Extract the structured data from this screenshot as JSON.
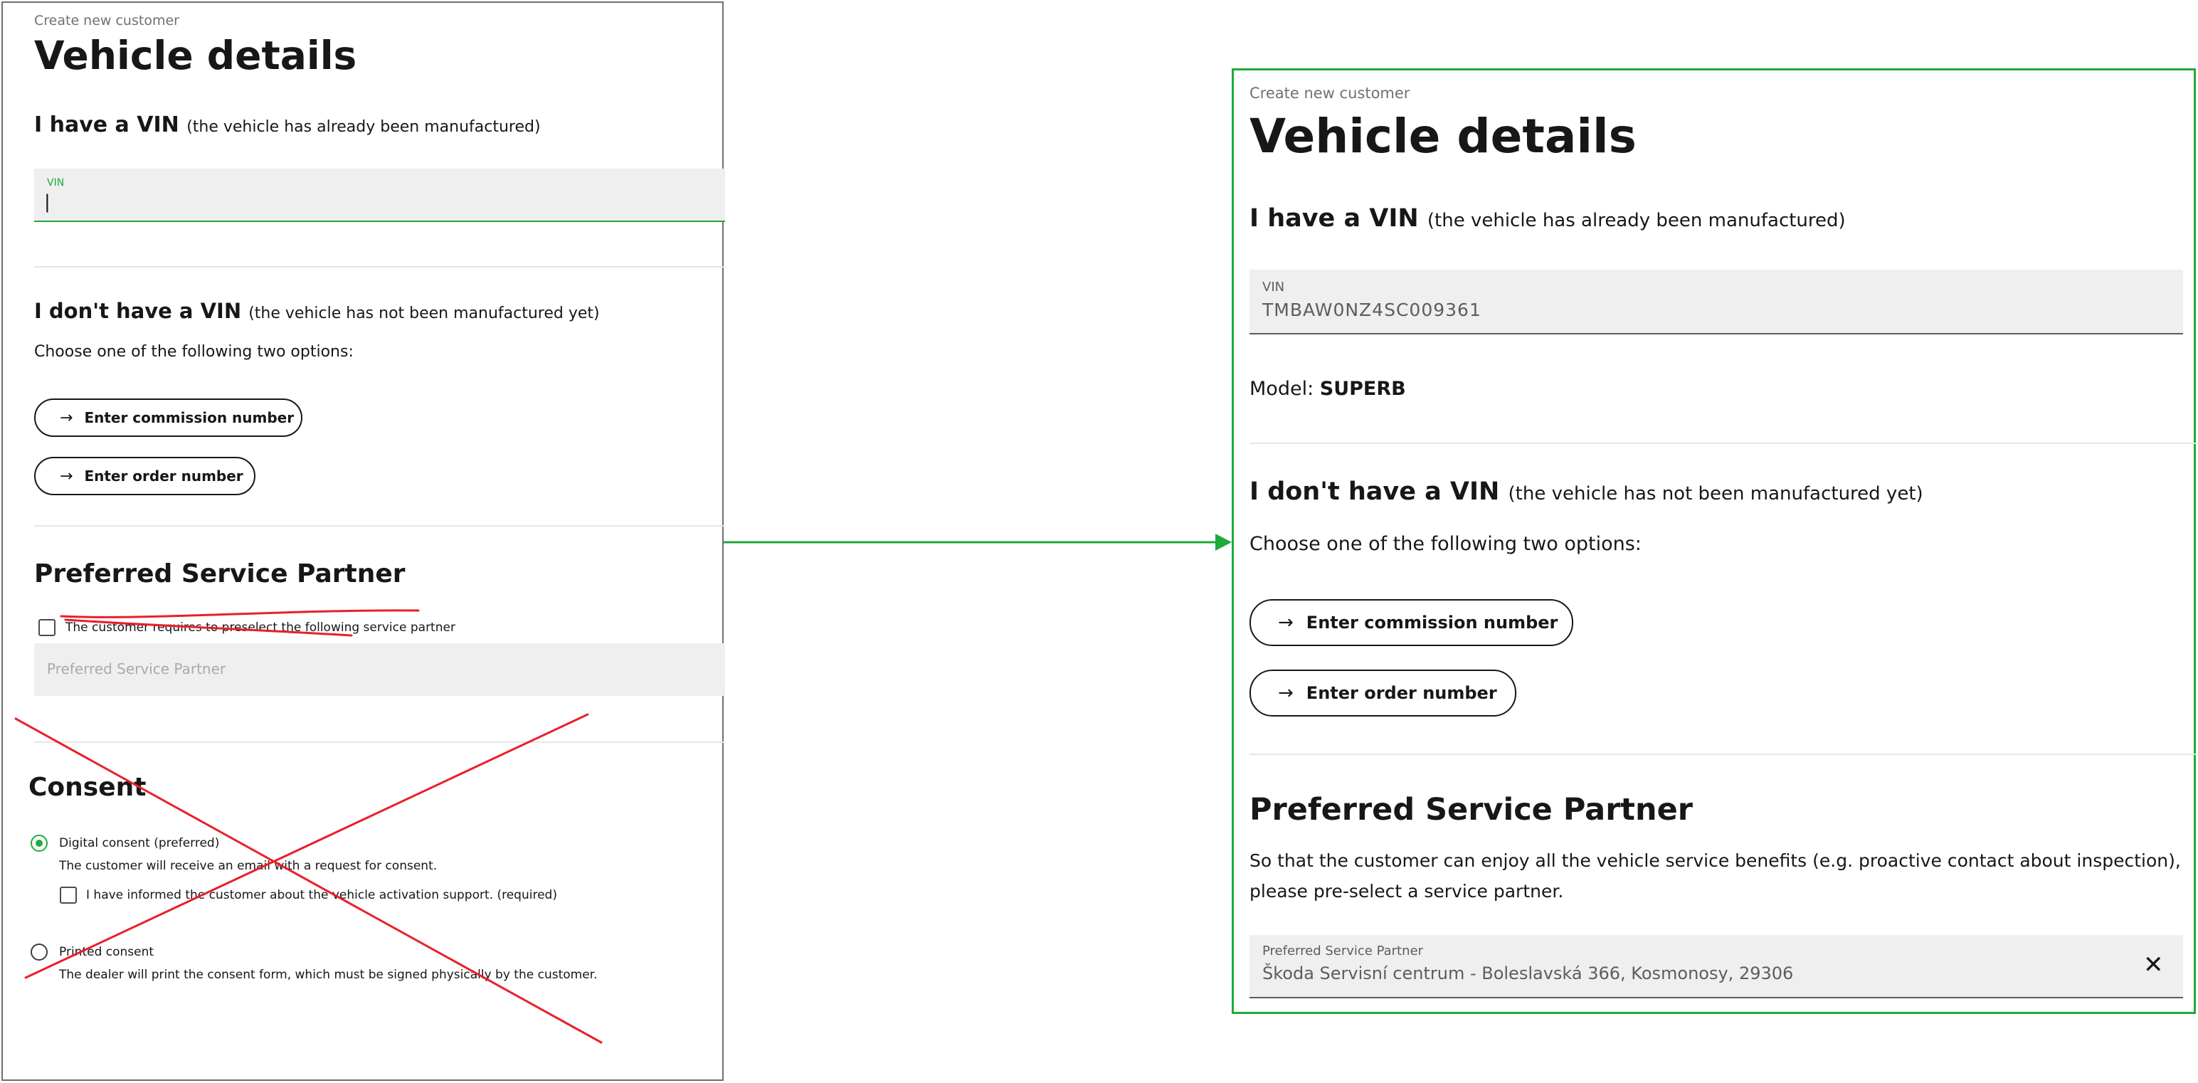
{
  "before": {
    "breadcrumb": "Create new customer",
    "page_title": "Vehicle details",
    "vin_section": {
      "heading": "I have a VIN",
      "heading_note": "(the vehicle has already been manufactured)",
      "vin_field": {
        "label": "VIN",
        "value": "|"
      }
    },
    "no_vin_section": {
      "heading": "I don't have a VIN",
      "heading_note": "(the vehicle has not been manufactured yet)",
      "instruction": "Choose one of the following two options:",
      "commission_button": "Enter commission number",
      "order_button": "Enter order number"
    },
    "service_partner": {
      "heading": "Preferred Service Partner",
      "checkbox_label": "The customer requires to preselect the following service partner",
      "field_placeholder": "Preferred Service Partner"
    },
    "consent": {
      "heading": "Consent",
      "digital_label": "Digital consent (preferred)",
      "digital_desc": "The customer will receive an email with a request for consent.",
      "activation_checkbox_label": "I have informed the customer about the vehicle activation support. (required)",
      "printed_label": "Printed consent",
      "printed_desc": "The dealer will print the consent form, which must be signed physically by the customer."
    }
  },
  "after": {
    "breadcrumb": "Create new customer",
    "page_title": "Vehicle details",
    "vin_section": {
      "heading": "I have a VIN",
      "heading_note": "(the vehicle has already been manufactured)",
      "vin_field": {
        "label": "VIN",
        "value": "TMBAW0NZ4SC009361"
      },
      "model_label": "Model:",
      "model_value": "SUPERB"
    },
    "no_vin_section": {
      "heading": "I don't have a VIN",
      "heading_note": "(the vehicle has not been manufactured yet)",
      "instruction": "Choose one of the following two options:",
      "commission_button": "Enter commission number",
      "order_button": "Enter order number"
    },
    "service_partner": {
      "heading": "Preferred Service Partner",
      "description_line1": "So that the customer can enjoy all the vehicle service benefits (e.g. proactive contact about inspection),",
      "description_line2": "please pre-select a service partner.",
      "field_label": "Preferred Service Partner",
      "field_value": "Škoda Servisní centrum - Boleslavská 366, Kosmonosy, 29306"
    }
  },
  "colors": {
    "accent_green": "#1faa3a",
    "strike_red": "#e8202a",
    "field_bg": "#efefef"
  },
  "icons": {
    "arrow": "→",
    "clear": "✕"
  }
}
